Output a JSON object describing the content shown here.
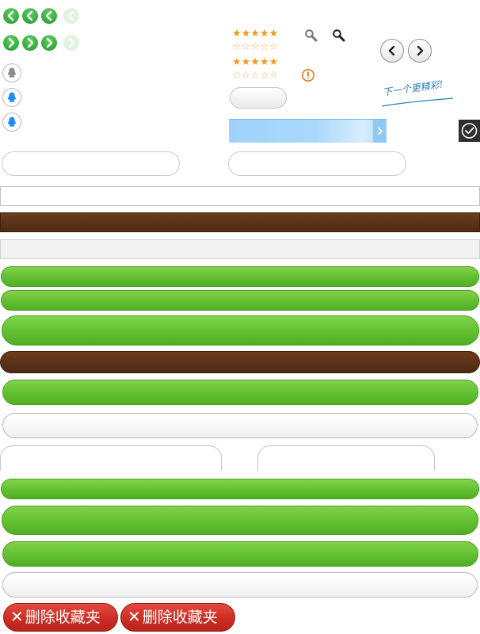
{
  "ratings": {
    "row1": "★★★★★",
    "row2": "☆☆☆☆☆",
    "row3": "★★★★★",
    "row4": "☆☆☆☆☆"
  },
  "handwriting": "下一个更精彩!",
  "delete_buttons": [
    {
      "icon": "✕",
      "label": "删除收藏夹"
    },
    {
      "icon": "✕",
      "label": "删除收藏夹"
    }
  ],
  "colors": {
    "green": "#67c334",
    "brown": "#5a3118",
    "red": "#cc2e24",
    "star": "#f29a1c",
    "progress_blue": "#9fd3fb",
    "warning": "#e07a20"
  },
  "icons": [
    "chevron-left-icon",
    "chevron-right-icon",
    "qq-penguin-icon",
    "search-icon",
    "warning-icon",
    "check-circle-icon",
    "close-icon"
  ]
}
